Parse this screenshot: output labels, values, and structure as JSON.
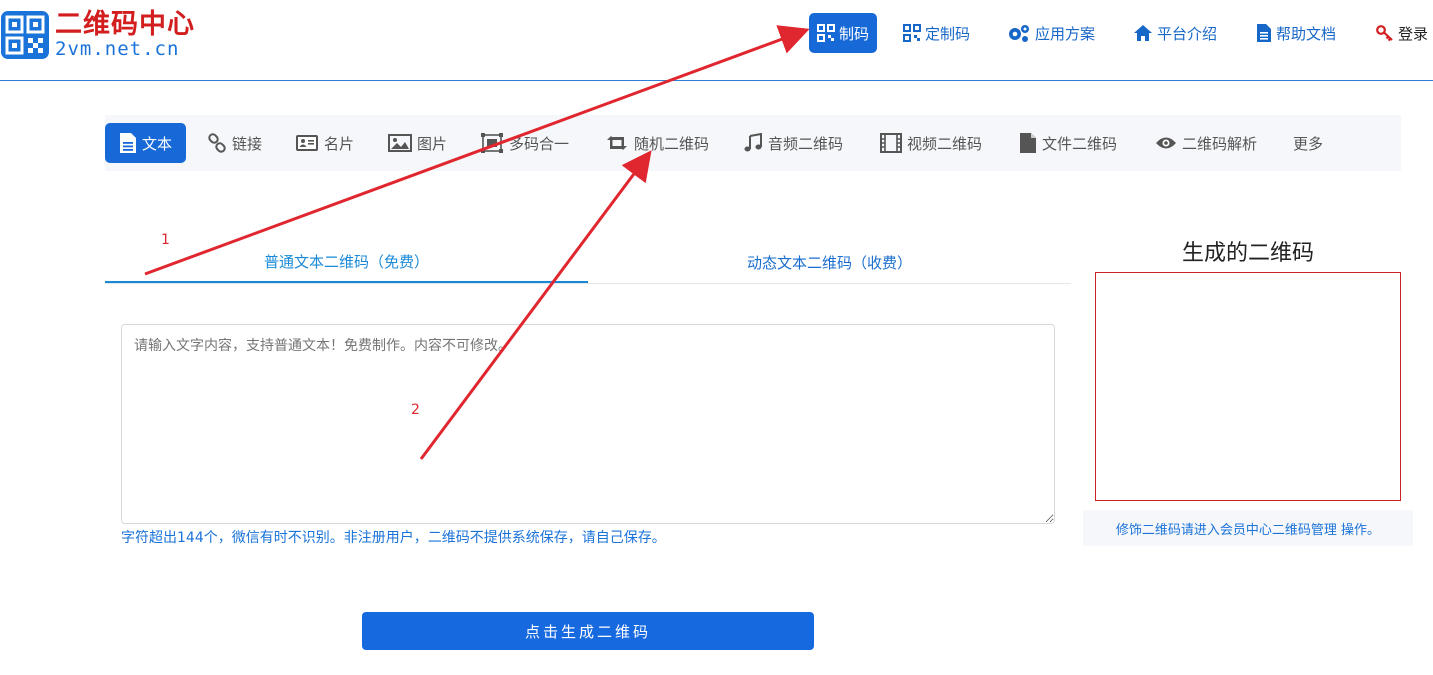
{
  "logo": {
    "title": "二维码中心",
    "subtitle": "2vm.net.cn"
  },
  "nav": {
    "items": [
      {
        "label": "制码",
        "icon": "qrcode-icon",
        "active": true
      },
      {
        "label": "定制码",
        "icon": "qrcode-icon"
      },
      {
        "label": "应用方案",
        "icon": "gears-icon"
      },
      {
        "label": "平台介绍",
        "icon": "home-icon"
      },
      {
        "label": "帮助文档",
        "icon": "document-icon"
      },
      {
        "label": "登录",
        "icon": "key-icon"
      }
    ]
  },
  "categories": [
    {
      "label": "文本",
      "icon": "file-text-icon",
      "active": true
    },
    {
      "label": "链接",
      "icon": "link-icon"
    },
    {
      "label": "名片",
      "icon": "id-card-icon"
    },
    {
      "label": "图片",
      "icon": "image-icon"
    },
    {
      "label": "多码合一",
      "icon": "object-group-icon"
    },
    {
      "label": "随机二维码",
      "icon": "retweet-icon"
    },
    {
      "label": "音频二维码",
      "icon": "music-icon"
    },
    {
      "label": "视频二维码",
      "icon": "film-icon"
    },
    {
      "label": "文件二维码",
      "icon": "file-icon"
    },
    {
      "label": "二维码解析",
      "icon": "eye-icon"
    },
    {
      "label": "更多",
      "icon": ""
    }
  ],
  "subtabs": [
    {
      "label": "普通文本二维码（免费）",
      "active": true
    },
    {
      "label": "动态文本二维码（收费）"
    }
  ],
  "editor": {
    "placeholder": "请输入文字内容，支持普通文本！免费制作。内容不可修改。",
    "value": "",
    "hint": "字符超出144个，微信有时不识别。非注册用户，二维码不提供系统保存，请自己保存。"
  },
  "generate_button": "点击生成二维码",
  "result": {
    "title": "生成的二维码",
    "note": "修饰二维码请进入会员中心二维码管理 操作。"
  },
  "annotations": {
    "labels": [
      "1",
      "2"
    ],
    "color": "#e0262e"
  },
  "colors": {
    "primary": "#1769d8",
    "accent_red": "#d21e1e"
  }
}
